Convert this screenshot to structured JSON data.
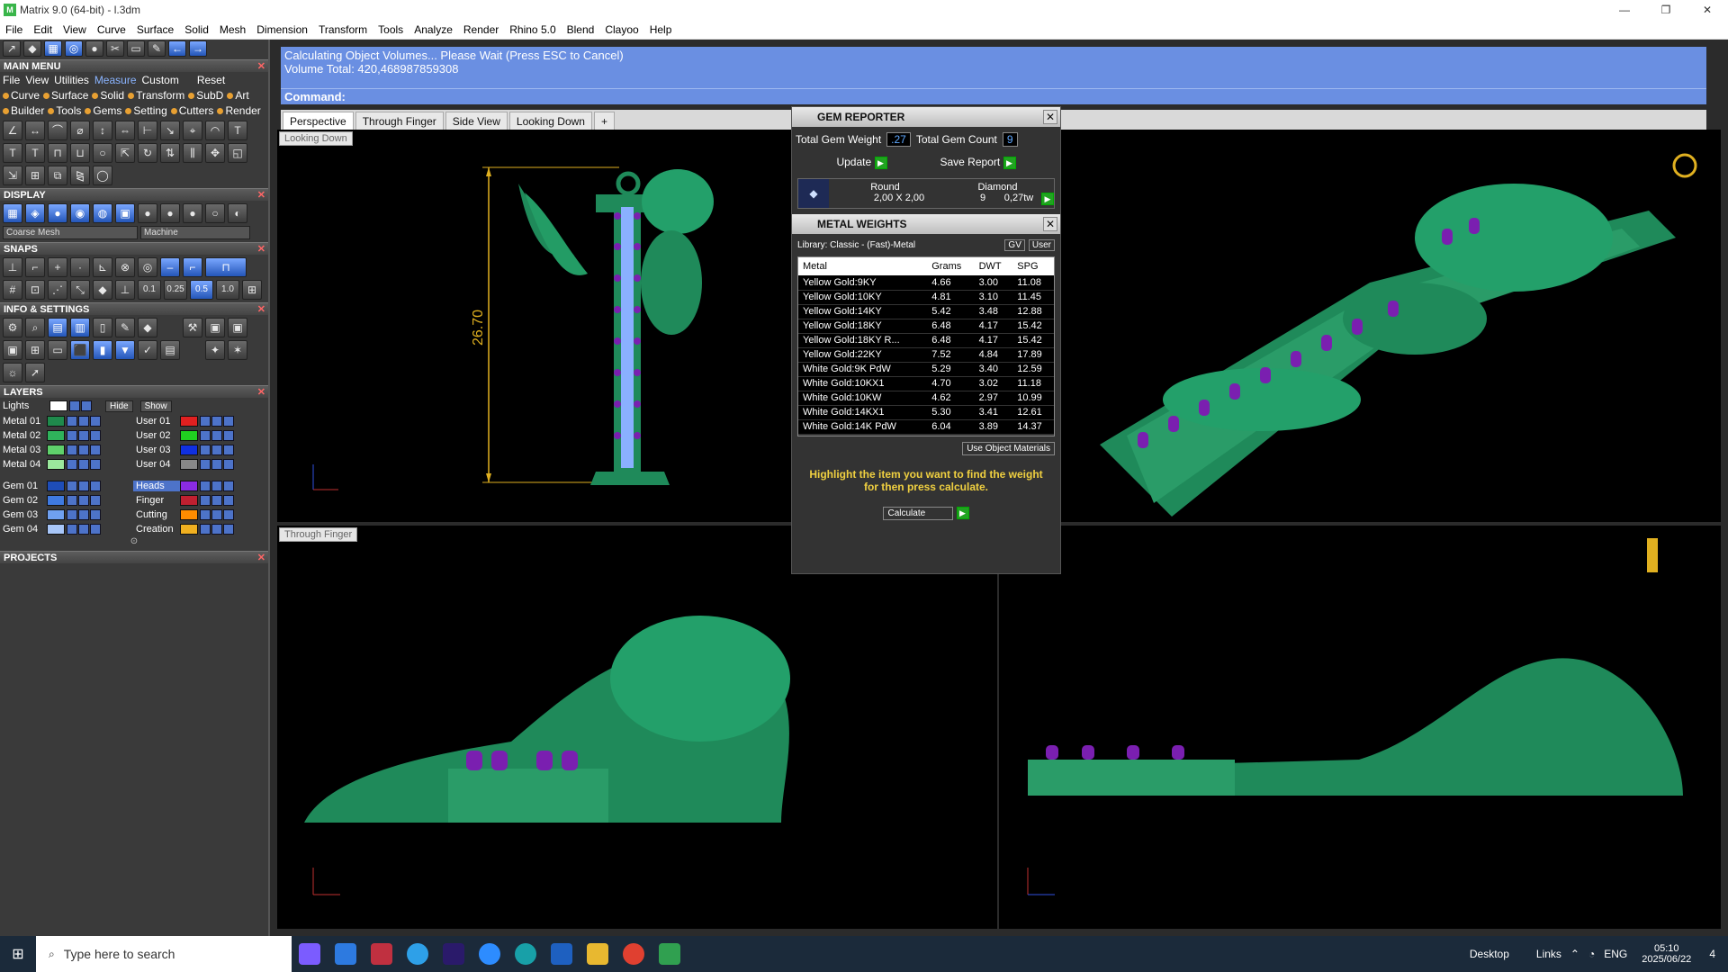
{
  "window": {
    "title": "Matrix 9.0 (64-bit) - l.3dm",
    "min": "—",
    "max": "❐",
    "close": "✕"
  },
  "menubar": [
    "File",
    "Edit",
    "View",
    "Curve",
    "Surface",
    "Solid",
    "Mesh",
    "Dimension",
    "Transform",
    "Tools",
    "Analyze",
    "Render",
    "Rhino 5.0",
    "Blend",
    "Clayoo",
    "Help"
  ],
  "main_menu": {
    "title": "MAIN MENU",
    "row1": [
      "File",
      "View",
      "Utilities",
      "Measure",
      "Custom",
      "Reset"
    ],
    "row1_active": "Measure",
    "row2": [
      {
        "label": "Curve",
        "color": "#e8a032"
      },
      {
        "label": "Surface",
        "color": "#e8a032"
      },
      {
        "label": "Solid",
        "color": "#e8a032"
      },
      {
        "label": "Transform",
        "color": "#e8a032"
      },
      {
        "label": "SubD",
        "color": "#e8a032"
      },
      {
        "label": "Art",
        "color": "#e8a032"
      }
    ],
    "row3": [
      {
        "label": "Builder",
        "color": "#e8a032"
      },
      {
        "label": "Tools",
        "color": "#e8a032"
      },
      {
        "label": "Gems",
        "color": "#e8a032"
      },
      {
        "label": "Setting",
        "color": "#e8a032"
      },
      {
        "label": "Cutters",
        "color": "#e8a032"
      },
      {
        "label": "Render",
        "color": "#e8a032"
      }
    ]
  },
  "display": {
    "title": "DISPLAY",
    "mesh": "Coarse Mesh",
    "material": "Machine"
  },
  "snaps": {
    "title": "SNAPS",
    "values": [
      "0.1",
      "0.25",
      "0.5",
      "1.0"
    ]
  },
  "info": {
    "title": "INFO & SETTINGS"
  },
  "layers": {
    "title": "LAYERS",
    "lights": "Lights",
    "hide": "Hide",
    "show": "Show",
    "left": [
      {
        "name": "Metal 01",
        "color": "#1f8a4c"
      },
      {
        "name": "Metal 02",
        "color": "#2fb35b"
      },
      {
        "name": "Metal 03",
        "color": "#5fd16b"
      },
      {
        "name": "Metal 04",
        "color": "#9be89d"
      },
      {
        "name": "Gem 01",
        "color": "#1e4db8"
      },
      {
        "name": "Gem 02",
        "color": "#3f7ae0"
      },
      {
        "name": "Gem 03",
        "color": "#6fa0f0"
      },
      {
        "name": "Gem 04",
        "color": "#a8c6f8"
      }
    ],
    "right": [
      {
        "name": "User 01",
        "color": "#e02020"
      },
      {
        "name": "User 02",
        "color": "#20d020"
      },
      {
        "name": "User 03",
        "color": "#1030e0"
      },
      {
        "name": "User 04",
        "color": "#888888"
      },
      {
        "name": "Heads",
        "color": "#8a2be2"
      },
      {
        "name": "Finger",
        "color": "#c02030"
      },
      {
        "name": "Cutting",
        "color": "#ff8c00"
      },
      {
        "name": "Creation",
        "color": "#f0b020"
      }
    ]
  },
  "projects": {
    "title": "PROJECTS"
  },
  "command": {
    "line1": "Calculating Object Volumes... Please Wait (Press ESC to Cancel)",
    "line2": "Volume Total: 420,468987859308",
    "prompt": "Command:"
  },
  "tabs": [
    "Perspective",
    "Through Finger",
    "Side View",
    "Looking Down"
  ],
  "tab_add": "+",
  "viewports": {
    "top_left": "Looking Down",
    "bottom_left": "Through Finger",
    "dimension": "26.70"
  },
  "gem_reporter": {
    "title": "GEM REPORTER",
    "total_weight_label": "Total Gem Weight",
    "total_weight": ".27",
    "total_count_label": "Total Gem Count",
    "total_count": "9",
    "update": "Update",
    "save": "Save Report",
    "shape": "Round",
    "material": "Diamond",
    "size": "2,00 X 2,00",
    "count": "9",
    "weight": "0,27tw"
  },
  "metal_weights": {
    "title": "METAL WEIGHTS",
    "library": "Library: Classic - (Fast)-Metal",
    "gv": "GV",
    "user": "User",
    "headers": [
      "Metal",
      "Grams",
      "DWT",
      "SPG"
    ],
    "rows": [
      [
        "Yellow Gold:9KY",
        "4.66",
        "3.00",
        "11.08"
      ],
      [
        "Yellow Gold:10KY",
        "4.81",
        "3.10",
        "11.45"
      ],
      [
        "Yellow Gold:14KY",
        "5.42",
        "3.48",
        "12.88"
      ],
      [
        "Yellow Gold:18KY",
        "6.48",
        "4.17",
        "15.42"
      ],
      [
        "Yellow Gold:18KY R...",
        "6.48",
        "4.17",
        "15.42"
      ],
      [
        "Yellow Gold:22KY",
        "7.52",
        "4.84",
        "17.89"
      ],
      [
        "White Gold:9K PdW",
        "5.29",
        "3.40",
        "12.59"
      ],
      [
        "White Gold:10KX1",
        "4.70",
        "3.02",
        "11.18"
      ],
      [
        "White Gold:10KW",
        "4.62",
        "2.97",
        "10.99"
      ],
      [
        "White Gold:14KX1",
        "5.30",
        "3.41",
        "12.61"
      ],
      [
        "White Gold:14K PdW",
        "6.04",
        "3.89",
        "14.37"
      ]
    ],
    "use_object_materials": "Use Object Materials",
    "hint": "Highlight the item you want to find the weight for then press calculate.",
    "calculate": "Calculate"
  },
  "taskbar": {
    "search_placeholder": "Type here to search",
    "desktop": "Desktop",
    "links": "Links",
    "lang": "ENG",
    "time": "05:10",
    "date": "2025/06/22",
    "notif": "4"
  }
}
